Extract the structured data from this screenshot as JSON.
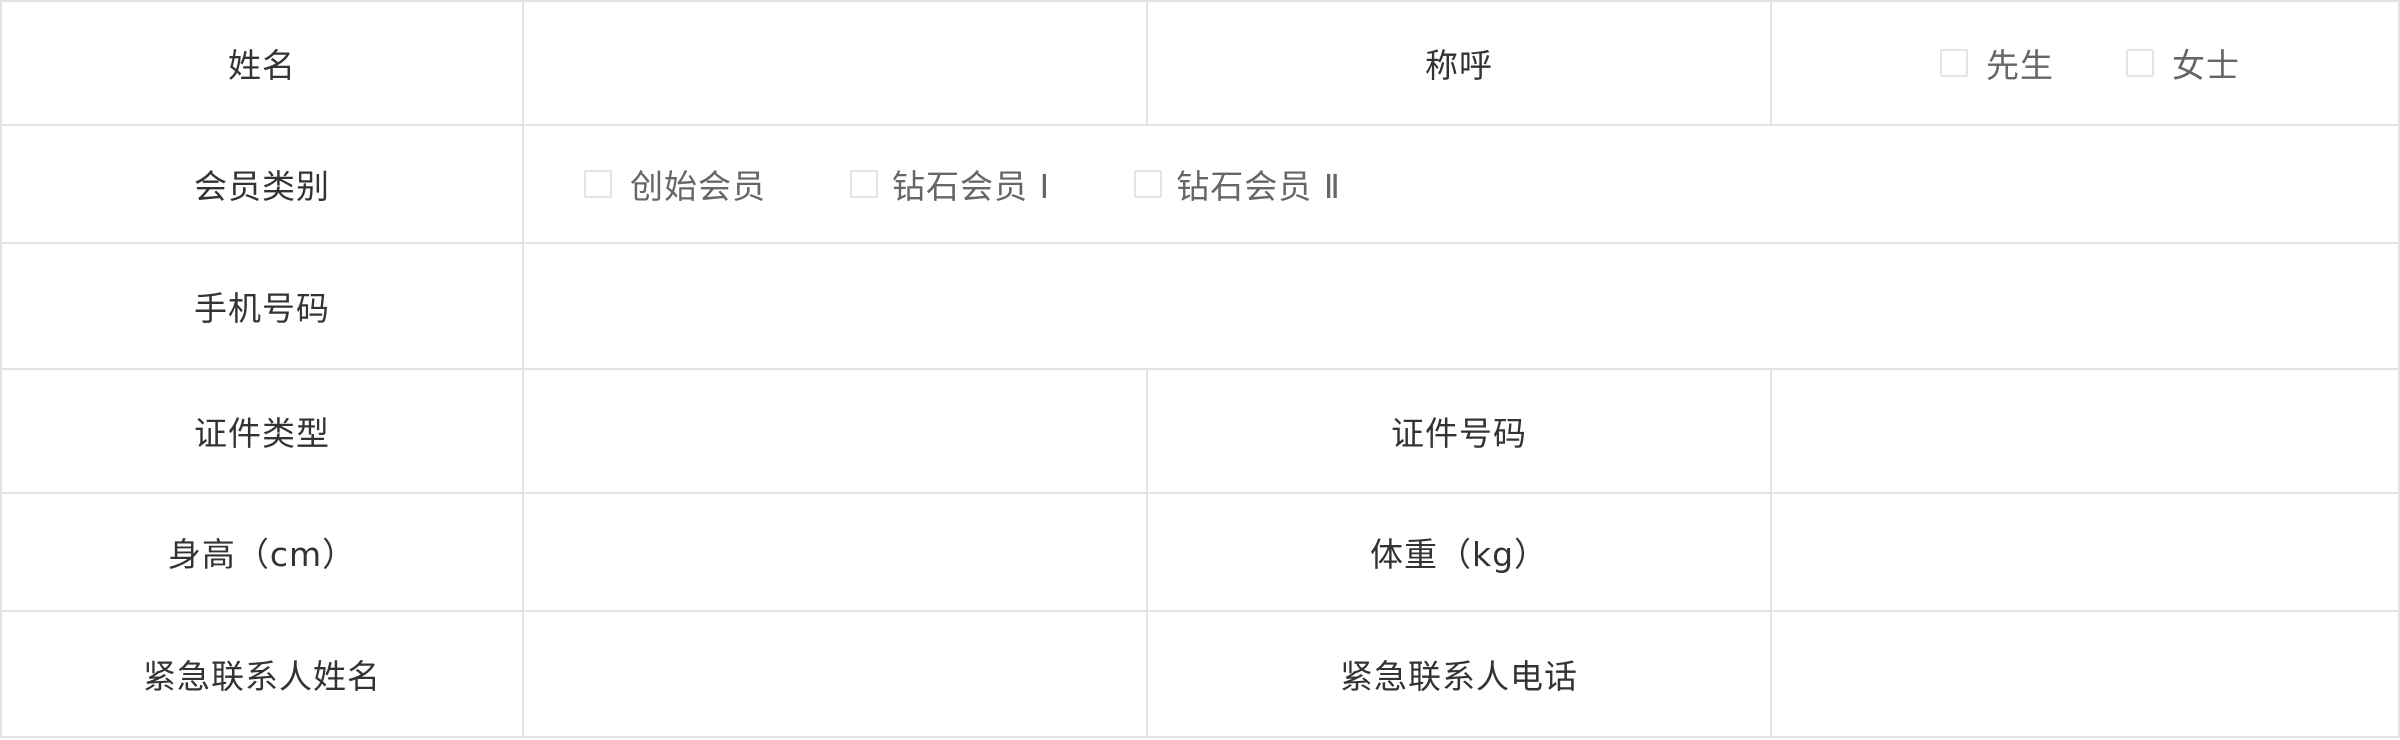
{
  "form": {
    "row1": {
      "name_label": "姓名",
      "name_value": "",
      "title_label": "称呼",
      "title_options": [
        "先生",
        "女士"
      ]
    },
    "row2": {
      "member_type_label": "会员类别",
      "member_options": [
        "创始会员",
        "钻石会员 Ⅰ",
        "钻石会员 Ⅱ"
      ]
    },
    "row3": {
      "phone_label": "手机号码",
      "phone_value": ""
    },
    "row4": {
      "id_type_label": "证件类型",
      "id_type_value": "",
      "id_number_label": "证件号码",
      "id_number_value": ""
    },
    "row5": {
      "height_label": "身高（cm）",
      "height_value": "",
      "weight_label": "体重（kg）",
      "weight_value": ""
    },
    "row6": {
      "emergency_name_label": "紧急联系人姓名",
      "emergency_name_value": "",
      "emergency_phone_label": "紧急联系人电话",
      "emergency_phone_value": ""
    }
  },
  "colors": {
    "border": "#e3e3e3",
    "label_text": "#333333",
    "option_text": "#666666",
    "checkbox_border": "#e4e4e4"
  }
}
